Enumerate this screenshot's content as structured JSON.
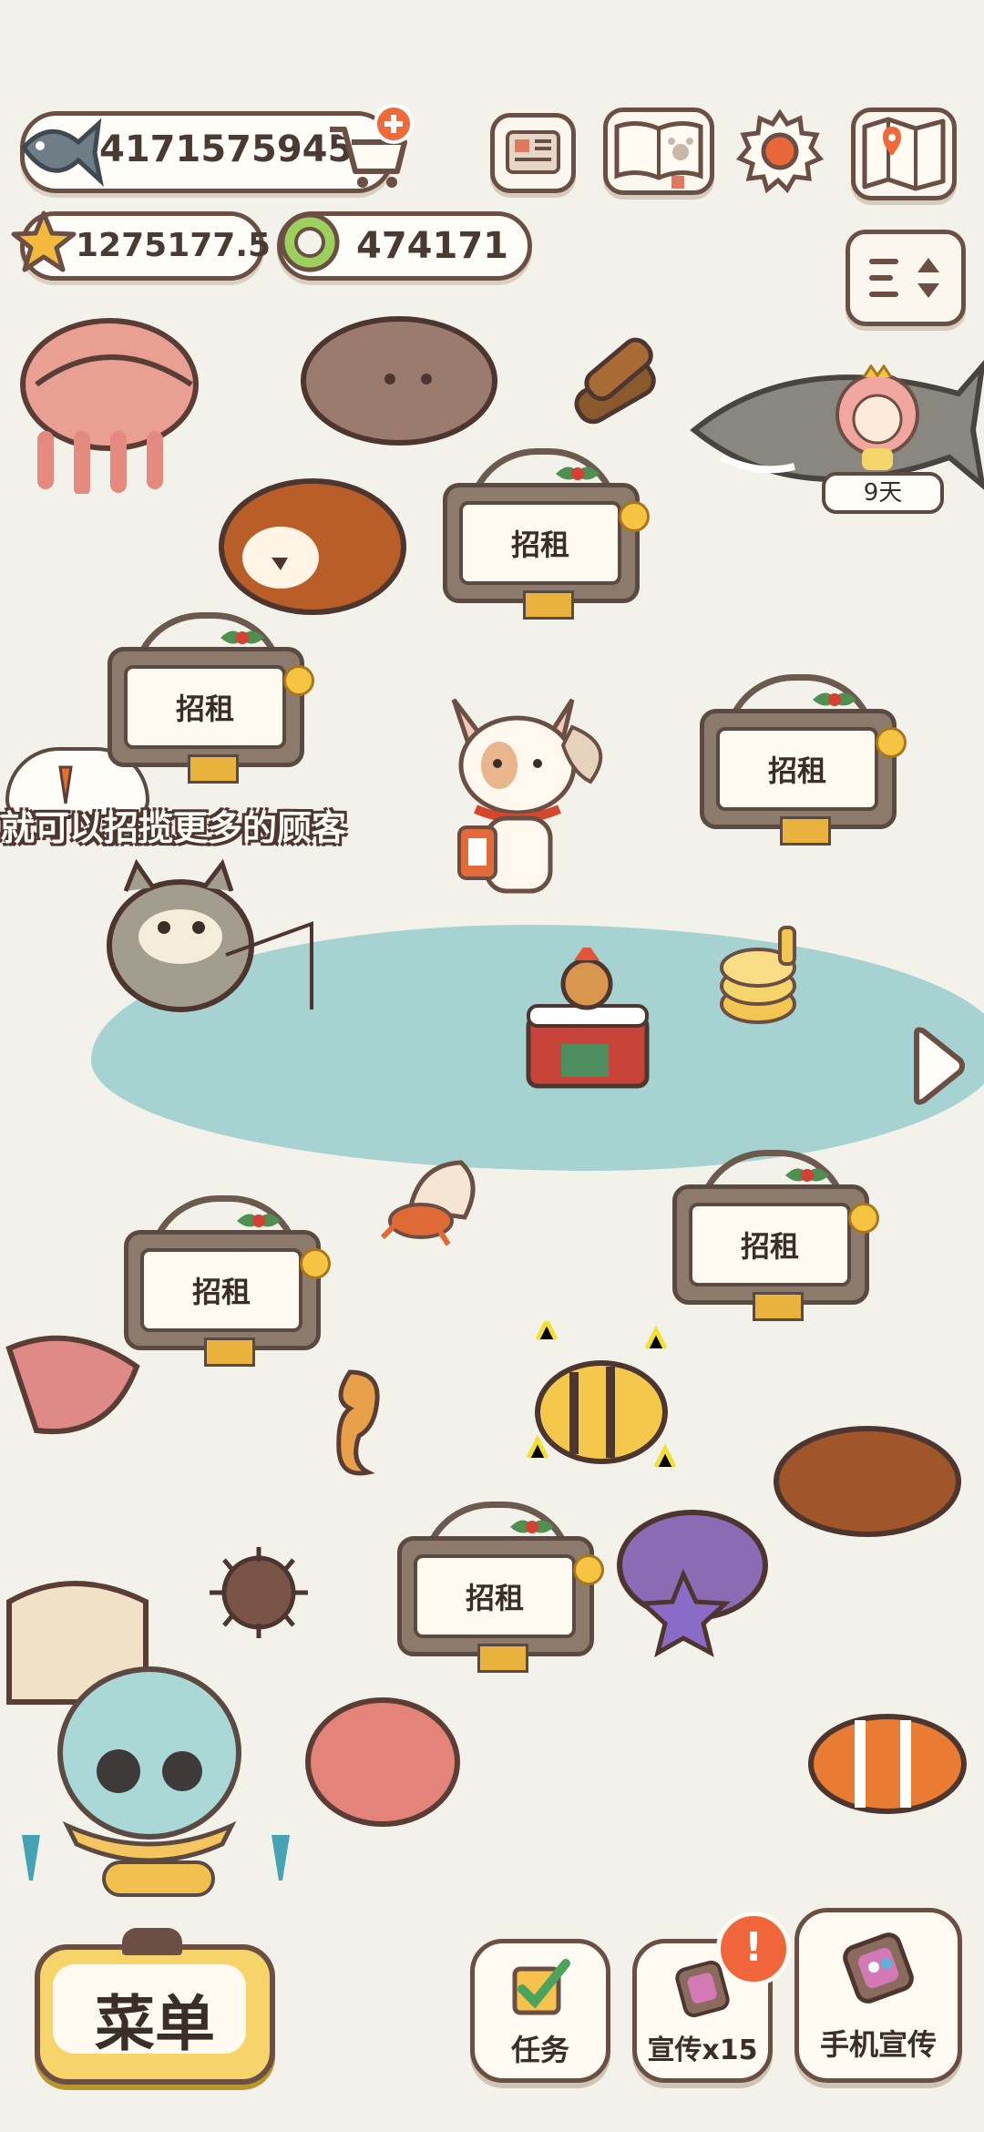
{
  "currency": {
    "fish": "4171575945",
    "star": "1275177.5",
    "ring": "474171"
  },
  "signs": [
    "招租",
    "招租",
    "招租",
    "招租",
    "招租",
    "招租"
  ],
  "tip_text": "就可以招揽更多的顾客",
  "badge_days": "9天",
  "bottom": {
    "menu": "菜单",
    "tasks": "任务",
    "promo": "宣传x15",
    "phone_promo": "手机宣传",
    "notice": "!"
  },
  "colors": {
    "background": "#f3f2ea",
    "outline": "#6b4f45",
    "water": "#a6d3d2",
    "menu_yellow": "#f7d46a",
    "alert_orange": "#f0663a"
  },
  "icons": [
    "fish-icon",
    "cart-plus-icon",
    "star-icon",
    "ring-icon",
    "newspaper-icon",
    "paw-book-icon",
    "gear-icon",
    "map-icon",
    "sort-icon",
    "right-arrow-icon",
    "check-icon",
    "phone-promo-icon"
  ]
}
